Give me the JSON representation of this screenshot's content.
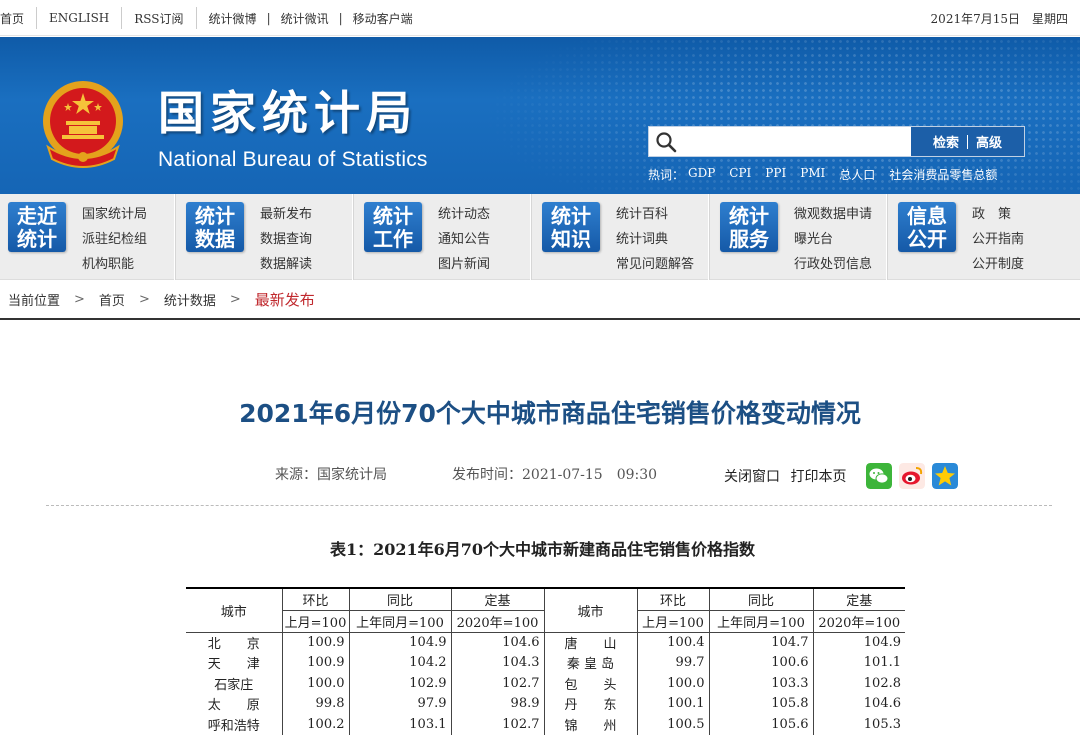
{
  "topbar": {
    "links": [
      "首页",
      "ENGLISH",
      "RSS订阅"
    ],
    "weibo": "统计微博",
    "weixin": "统计微讯",
    "mobile": "移动客户端",
    "date": "2021年7月15日　星期四"
  },
  "header": {
    "name_cn": "国家统计局",
    "name_en": "National Bureau of Statistics",
    "search": {
      "placeholder": "",
      "btn_search": "检索",
      "btn_advanced": "高级"
    },
    "hot_label": "热词：",
    "hot_words": [
      "GDP",
      "CPI",
      "PPI",
      "PMI",
      "总人口",
      "社会消费品零售总额"
    ]
  },
  "nav": [
    {
      "badge": [
        "走近",
        "统计"
      ],
      "items": [
        "国家统计局",
        "派驻纪检组",
        "机构职能"
      ]
    },
    {
      "badge": [
        "统计",
        "数据"
      ],
      "items": [
        "最新发布",
        "数据查询",
        "数据解读"
      ]
    },
    {
      "badge": [
        "统计",
        "工作"
      ],
      "items": [
        "统计动态",
        "通知公告",
        "图片新闻"
      ]
    },
    {
      "badge": [
        "统计",
        "知识"
      ],
      "items": [
        "统计百科",
        "统计词典",
        "常见问题解答"
      ]
    },
    {
      "badge": [
        "统计",
        "服务"
      ],
      "items": [
        "微观数据申请",
        "曝光台",
        "行政处罚信息"
      ]
    },
    {
      "badge": [
        "信息",
        "公开"
      ],
      "items": [
        "政　策",
        "公开指南",
        "公开制度"
      ]
    }
  ],
  "breadcrumb": {
    "location": "当前位置",
    "home": "首页",
    "section": "统计数据",
    "current": "最新发布"
  },
  "article": {
    "title": "2021年6月份70个大中城市商品住宅销售价格变动情况",
    "source": "来源：国家统计局",
    "published": "发布时间：2021-07-15　09:30",
    "close": "关闭窗口",
    "print": "打印本页"
  },
  "table": {
    "caption": "表1：2021年6月70个大中城市新建商品住宅销售价格指数",
    "headers": {
      "city": "城市",
      "mom": "环比",
      "yoy": "同比",
      "base": "定基"
    },
    "subheaders": {
      "mom": "上月=100",
      "yoy": "上年同月=100",
      "base": "2020年=100"
    },
    "rows": [
      {
        "l": [
          "北　　京",
          "100.9",
          "104.9",
          "104.6"
        ],
        "r": [
          "唐　　山",
          "100.4",
          "104.7",
          "104.9"
        ]
      },
      {
        "l": [
          "天　　津",
          "100.9",
          "104.2",
          "104.3"
        ],
        "r": [
          "秦 皇 岛",
          "99.7",
          "100.6",
          "101.1"
        ]
      },
      {
        "l": [
          "石家庄",
          "100.0",
          "102.9",
          "102.7"
        ],
        "r": [
          "包　　头",
          "100.0",
          "103.3",
          "102.8"
        ]
      },
      {
        "l": [
          "太　　原",
          "99.8",
          "97.9",
          "98.9"
        ],
        "r": [
          "丹　　东",
          "100.1",
          "105.8",
          "104.6"
        ]
      },
      {
        "l": [
          "呼和浩特",
          "100.2",
          "103.1",
          "102.7"
        ],
        "r": [
          "锦　　州",
          "100.5",
          "105.6",
          "105.3"
        ]
      }
    ]
  }
}
